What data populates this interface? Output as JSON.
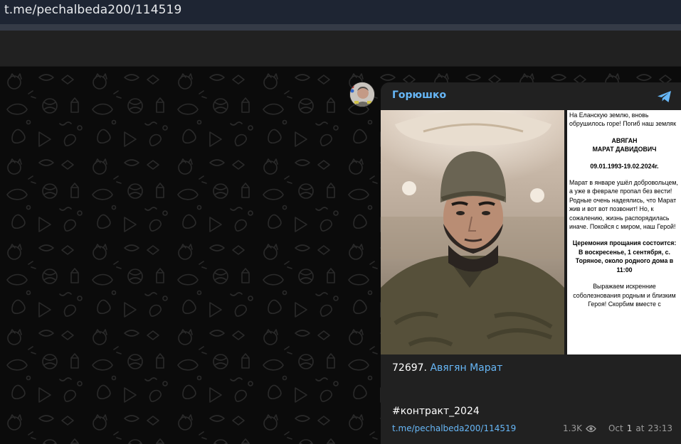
{
  "browser": {
    "url": "t.me/pechalbeda200/114519"
  },
  "post": {
    "channel_name": "Горюшко",
    "logo_icon": "telegram-icon",
    "avatar_icon": "channel-avatar",
    "notice": {
      "intro": "На Еланскую землю, вновь обрушилось горе! Погиб наш земляк",
      "surname": "АВЯГАН",
      "names": "МАРАТ ДАВИДОВИЧ",
      "dates": "09.01.1993-19.02.2024г.",
      "story": "Марат в январе ушёл добровольцем, а уже в феврале пропал без вести! Родные очень надеялись, что Марат жив и вот вот позвонит! Но, к сожалению, жизнь распорядилась иначе. Покойся с миром, наш Герой!",
      "ceremony_title": "Церемония прощания состоится:",
      "ceremony_details": "В воскресенье, 1 сентября, с. Торяное, около родного дома в 11:00",
      "condolences": "Выражаем искренние соболезнования родным и близким Героя! Скорбим вместе с"
    },
    "number": "72697.",
    "name_link": "Авягян Марат",
    "hashtag": "#контракт_2024",
    "footer": {
      "link": "t.me/pechalbeda200/114519",
      "views": "1.3K",
      "views_icon": "eye-icon",
      "date_prefix": "Oct",
      "date_day": "1",
      "date_at": "at",
      "time": "23:13"
    }
  },
  "colors": {
    "link": "#67b7f7",
    "bubble": "#212121",
    "chat_background": "#0b0b0b",
    "url_bar": "#1e2533"
  }
}
